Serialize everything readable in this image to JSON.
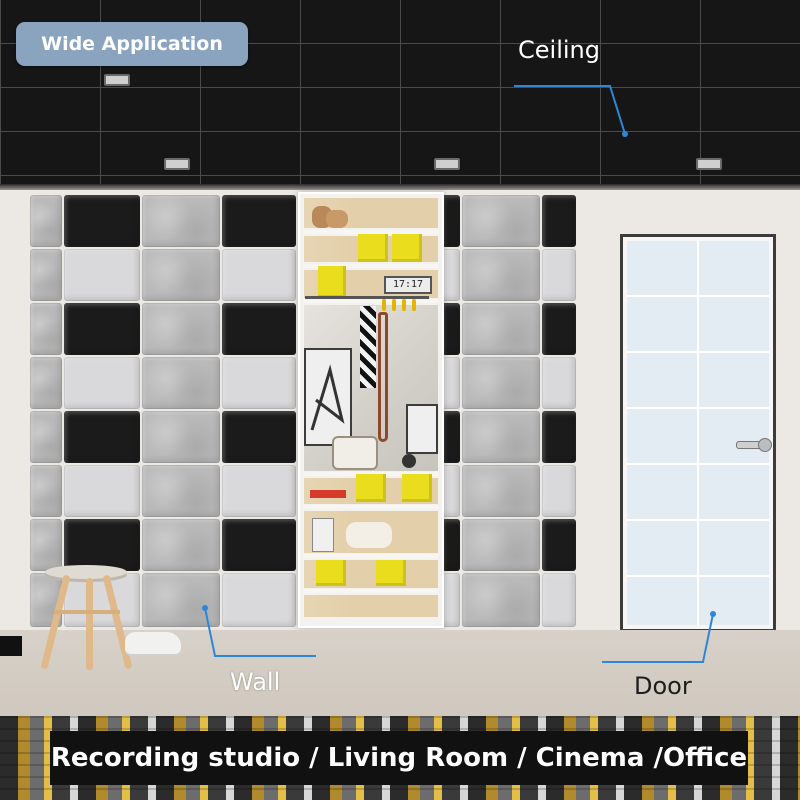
{
  "badge": {
    "label": "Wide Application",
    "color": "#8aa4bf"
  },
  "callouts": {
    "ceiling": "Ceiling",
    "wall": "Wall",
    "door": "Door",
    "line_color": "#2f86d6"
  },
  "banner": {
    "text": "Recording studio / Living Room / Cinema /Office"
  },
  "shelf": {
    "clock_text": "17:17"
  },
  "colors": {
    "panel_black": "#1b1b1c",
    "panel_light": "#d9d9db",
    "panel_concrete": "#b9b9ba",
    "box_yellow": "#e9dd1d",
    "ceiling": "#161616"
  },
  "icons": [
    "ceiling-light-icon",
    "door-handle-icon",
    "clock-icon",
    "radio-icon"
  ]
}
